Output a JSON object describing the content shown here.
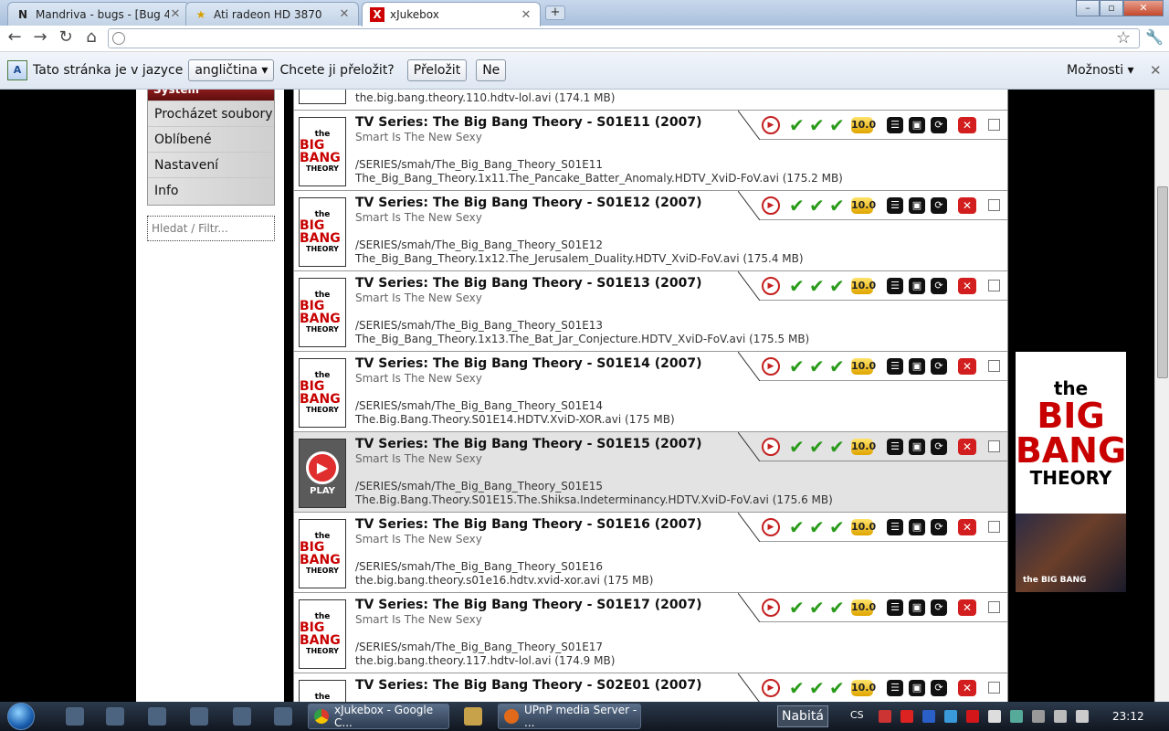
{
  "tabs": [
    {
      "label": "Mandriva - bugs - [Bug 4...",
      "favicon": "N"
    },
    {
      "label": "Ati radeon HD 3870",
      "favicon": "★"
    },
    {
      "label": "xJukebox",
      "favicon": "X"
    }
  ],
  "infobar": {
    "text": "Tato stránka je v jazyce",
    "language": "angličtina ▾",
    "question": "Chcete ji přeložit?",
    "translate_btn": "Přeložit",
    "no_btn": "Ne",
    "options": "Možnosti ▾"
  },
  "sidebar": {
    "header": "System",
    "items": [
      {
        "label": "Procházet soubory"
      },
      {
        "label": "Oblíbené"
      },
      {
        "label": "Nastavení"
      },
      {
        "label": "Info"
      }
    ],
    "search_placeholder": "Hledat / Filtr..."
  },
  "thumb_text": {
    "a": "the",
    "b": "BIG BANG",
    "c": "THEORY",
    "play": "PLAY"
  },
  "partial_top": {
    "file": "the.big.bang.theory.110.hdtv-lol.avi (174.1 MB)"
  },
  "rating": "10.0",
  "episodes": [
    {
      "title": "TV Series: The Big Bang Theory - S01E11 (2007)",
      "subtitle": "Smart Is The New Sexy",
      "path": "/SERIES/smah/The_Big_Bang_Theory_S01E11",
      "file": "The_Big_Bang_Theory.1x11.The_Pancake_Batter_Anomaly.HDTV_XviD-FoV.avi (175.2 MB)"
    },
    {
      "title": "TV Series: The Big Bang Theory - S01E12 (2007)",
      "subtitle": "Smart Is The New Sexy",
      "path": "/SERIES/smah/The_Big_Bang_Theory_S01E12",
      "file": "The_Big_Bang_Theory.1x12.The_Jerusalem_Duality.HDTV_XviD-FoV.avi (175.4 MB)"
    },
    {
      "title": "TV Series: The Big Bang Theory - S01E13 (2007)",
      "subtitle": "Smart Is The New Sexy",
      "path": "/SERIES/smah/The_Big_Bang_Theory_S01E13",
      "file": "The_Big_Bang_Theory.1x13.The_Bat_Jar_Conjecture.HDTV_XviD-FoV.avi (175.5 MB)"
    },
    {
      "title": "TV Series: The Big Bang Theory - S01E14 (2007)",
      "subtitle": "Smart Is The New Sexy",
      "path": "/SERIES/smah/The_Big_Bang_Theory_S01E14",
      "file": "The.Big.Bang.Theory.S01E14.HDTV.XviD-XOR.avi (175 MB)"
    },
    {
      "title": "TV Series: The Big Bang Theory - S01E15 (2007)",
      "subtitle": "Smart Is The New Sexy",
      "path": "/SERIES/smah/The_Big_Bang_Theory_S01E15",
      "file": "The.Big.Bang.Theory.S01E15.The.Shiksa.Indeterminancy.HDTV.XviD-FoV.avi (175.6 MB)"
    },
    {
      "title": "TV Series: The Big Bang Theory - S01E16 (2007)",
      "subtitle": "Smart Is The New Sexy",
      "path": "/SERIES/smah/The_Big_Bang_Theory_S01E16",
      "file": "the.big.bang.theory.s01e16.hdtv.xvid-xor.avi (175 MB)"
    },
    {
      "title": "TV Series: The Big Bang Theory - S01E17 (2007)",
      "subtitle": "Smart Is The New Sexy",
      "path": "/SERIES/smah/The_Big_Bang_Theory_S01E17",
      "file": "the.big.bang.theory.117.hdtv-lol.avi (174.9 MB)"
    },
    {
      "title": "TV Series: The Big Bang Theory - S02E01 (2007)",
      "subtitle": "",
      "path": "",
      "file": ""
    }
  ],
  "poster": {
    "a": "the",
    "b": "BIG",
    "c": "BANG",
    "d": "THEORY"
  },
  "fanart_label": "the BIG BANG",
  "taskbar": {
    "btn_chrome": "xJukebox - Google C...",
    "btn_upnp": "UPnP media Server - ...",
    "nabita": "Nabitá",
    "lang": "CS",
    "clock": "23:12"
  },
  "colors": {
    "accent_red": "#c80000",
    "check_green": "#2a9a1a",
    "rating_gold": "#e0a500"
  }
}
